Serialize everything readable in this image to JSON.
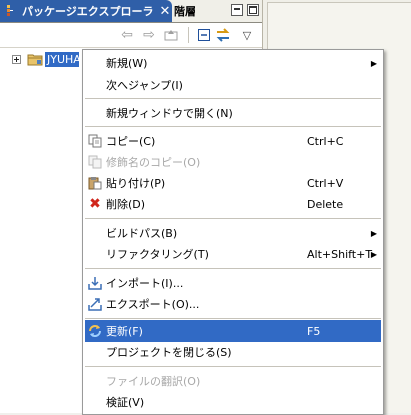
{
  "view": {
    "tabs": [
      {
        "label": "パッケージエクスプローラ",
        "close": "✕"
      },
      {
        "label": "階層"
      }
    ],
    "tree": {
      "project_label": "JYUHA"
    }
  },
  "context_menu": {
    "items": [
      {
        "label": "新規(W)",
        "accel": "",
        "submenu": true,
        "disabled": false,
        "icon": ""
      },
      {
        "label": "次へジャンプ(I)",
        "accel": "",
        "submenu": false,
        "disabled": false,
        "icon": ""
      },
      {
        "label": "新規ウィンドウで開く(N)",
        "accel": "",
        "submenu": false,
        "disabled": false,
        "icon": ""
      },
      {
        "label": "コピー(C)",
        "accel": "Ctrl+C",
        "submenu": false,
        "disabled": false,
        "icon": "copy-icon"
      },
      {
        "label": "修飾名のコピー(O)",
        "accel": "",
        "submenu": false,
        "disabled": true,
        "icon": "copy-qualified-icon"
      },
      {
        "label": "貼り付け(P)",
        "accel": "Ctrl+V",
        "submenu": false,
        "disabled": false,
        "icon": "paste-icon"
      },
      {
        "label": "削除(D)",
        "accel": "Delete",
        "submenu": false,
        "disabled": false,
        "icon": "delete-icon"
      },
      {
        "label": "ビルドパス(B)",
        "accel": "",
        "submenu": true,
        "disabled": false,
        "icon": ""
      },
      {
        "label": "リファクタリング(T)",
        "accel": "Alt+Shift+T",
        "submenu": true,
        "disabled": false,
        "icon": ""
      },
      {
        "label": "インポート(I)...",
        "accel": "",
        "submenu": false,
        "disabled": false,
        "icon": "import-icon"
      },
      {
        "label": "エクスポート(O)...",
        "accel": "",
        "submenu": false,
        "disabled": false,
        "icon": "export-icon"
      },
      {
        "label": "更新(F)",
        "accel": "F5",
        "submenu": false,
        "disabled": false,
        "selected": true,
        "icon": "refresh-icon"
      },
      {
        "label": "プロジェクトを閉じる(S)",
        "accel": "",
        "submenu": false,
        "disabled": false,
        "icon": ""
      },
      {
        "label": "ファイルの翻訳(O)",
        "accel": "",
        "submenu": false,
        "disabled": true,
        "icon": ""
      },
      {
        "label": "検証(V)",
        "accel": "",
        "submenu": false,
        "disabled": false,
        "icon": ""
      }
    ]
  },
  "colors": {
    "selection": "#316ac5",
    "active_tab": "#2f5fa8"
  }
}
